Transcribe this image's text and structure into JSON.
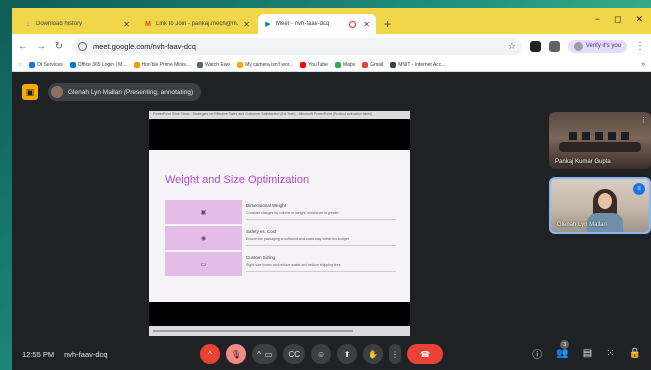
{
  "browser": {
    "tabs": [
      {
        "title": "Download history",
        "icon": "download-icon",
        "active": false
      },
      {
        "title": "Link to Join - pankaj.mech@m...",
        "icon": "gmail-icon",
        "active": false
      },
      {
        "title": "Meet - nvh-faav-dcq",
        "icon": "meet-icon",
        "active": true
      }
    ],
    "new_tab": "+",
    "window_controls": [
      "−",
      "✕"
    ],
    "url": "meet.google.com/nvh-faav-dcq",
    "profile_label": "Verify it's you",
    "bookmarks": [
      "Dt Services",
      "Office 365 Login | M...",
      "Hon'ble Prime Minis...",
      "Watch Ewe",
      "My camera isn't wor...",
      "YouTube",
      "Maps",
      "Gmail",
      "MNIT - Internet Acc..."
    ],
    "bookmarks_more": "»"
  },
  "meet": {
    "presenter_label": "Glenah Lyn Mallari (Presenting, annotating)",
    "presentation": {
      "header_text": "PowerPoint Slide Show - Strategies for Effective Sales and Customer Satisfaction (Ed-Tech) - Microsoft PowerPoint (Product activation failed)",
      "slide_title": "Weight and Size Optimization",
      "rows": [
        {
          "icon": "▣",
          "heading": "Dimensional Weight",
          "desc": "Consider charges by volume or weight, whichever is greater"
        },
        {
          "icon": "◉",
          "heading": "Safety vs. Cost",
          "desc": "Ensure the packaging is sufficient and costs stay within the budget"
        },
        {
          "icon": "▭",
          "heading": "Custom Sizing",
          "desc": "Right-size boxes and reduce waste and reduce shipping fees"
        }
      ]
    },
    "participants": [
      {
        "name": "Pankaj Kumar Gupta",
        "tile_action": "⋮"
      },
      {
        "name": "Glenah Lyn Mallari",
        "tile_action": "≡"
      }
    ],
    "time": "12:55 PM",
    "meeting_code": "nvh-faav-dcq",
    "controls": {
      "raise_caret": "^",
      "mic": "🎙",
      "cam_caret": "^",
      "cam": "▭",
      "captions": "CC",
      "emoji": "☺",
      "present": "⬆",
      "hand": "✋",
      "more": "⋮",
      "end": "☎"
    },
    "right_controls": {
      "info": "ⓘ",
      "people": "👥",
      "people_count": "3",
      "chat": "▤",
      "activities": "⁙",
      "lock": "🔒"
    }
  }
}
